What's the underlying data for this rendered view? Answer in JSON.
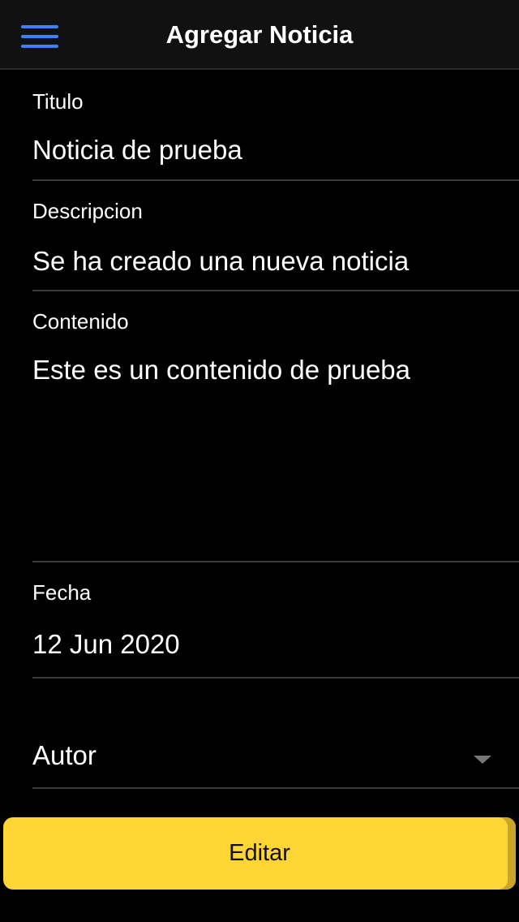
{
  "toolbar": {
    "title": "Agregar Noticia",
    "menu_icon": "hamburger-menu-icon",
    "accent_color": "#3b82f6"
  },
  "form": {
    "titulo": {
      "label": "Titulo",
      "value": "Noticia de prueba"
    },
    "descripcion": {
      "label": "Descripcion",
      "value": "Se ha creado una nueva noticia"
    },
    "contenido": {
      "label": "Contenido",
      "value": "Este es un contenido de prueba"
    },
    "fecha": {
      "label": "Fecha",
      "value": "12 Jun 2020"
    },
    "autor": {
      "placeholder": "Autor",
      "dropdown_icon": "caret-down-icon"
    }
  },
  "actions": {
    "submit_label": "Editar",
    "submit_color": "#fdd535"
  }
}
